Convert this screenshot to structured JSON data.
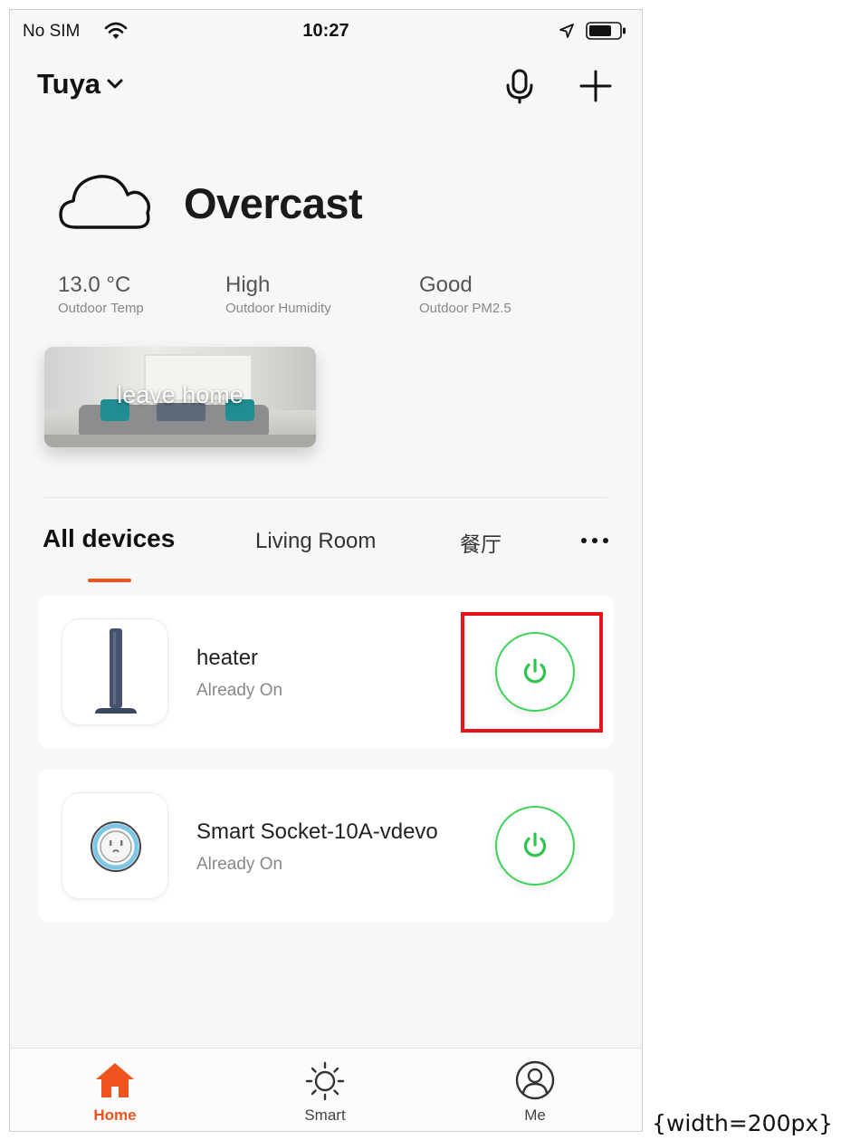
{
  "status_bar": {
    "carrier": "No SIM",
    "time": "10:27"
  },
  "header": {
    "home_name": "Tuya"
  },
  "weather": {
    "condition": "Overcast",
    "metrics": [
      {
        "value": "13.0 °C",
        "label": "Outdoor Temp"
      },
      {
        "value": "High",
        "label": "Outdoor Humidity"
      },
      {
        "value": "Good",
        "label": "Outdoor PM2.5"
      }
    ]
  },
  "scene": {
    "label": "leave home"
  },
  "tabs": [
    {
      "label": "All devices",
      "active": true
    },
    {
      "label": "Living Room"
    },
    {
      "label": "餐厅"
    }
  ],
  "devices": [
    {
      "name": "heater",
      "status": "Already On",
      "icon": "heater-icon"
    },
    {
      "name": "Smart Socket-10A-vdevo",
      "status": "Already On",
      "icon": "socket-icon"
    }
  ],
  "tabbar": [
    {
      "label": "Home",
      "icon": "home-icon",
      "active": true
    },
    {
      "label": "Smart",
      "icon": "sun-icon"
    },
    {
      "label": "Me",
      "icon": "user-icon"
    }
  ],
  "colors": {
    "accent": "#f0541e",
    "power_on": "#3cd35a",
    "highlight": "#e8141a"
  },
  "caption": "{width=200px}"
}
